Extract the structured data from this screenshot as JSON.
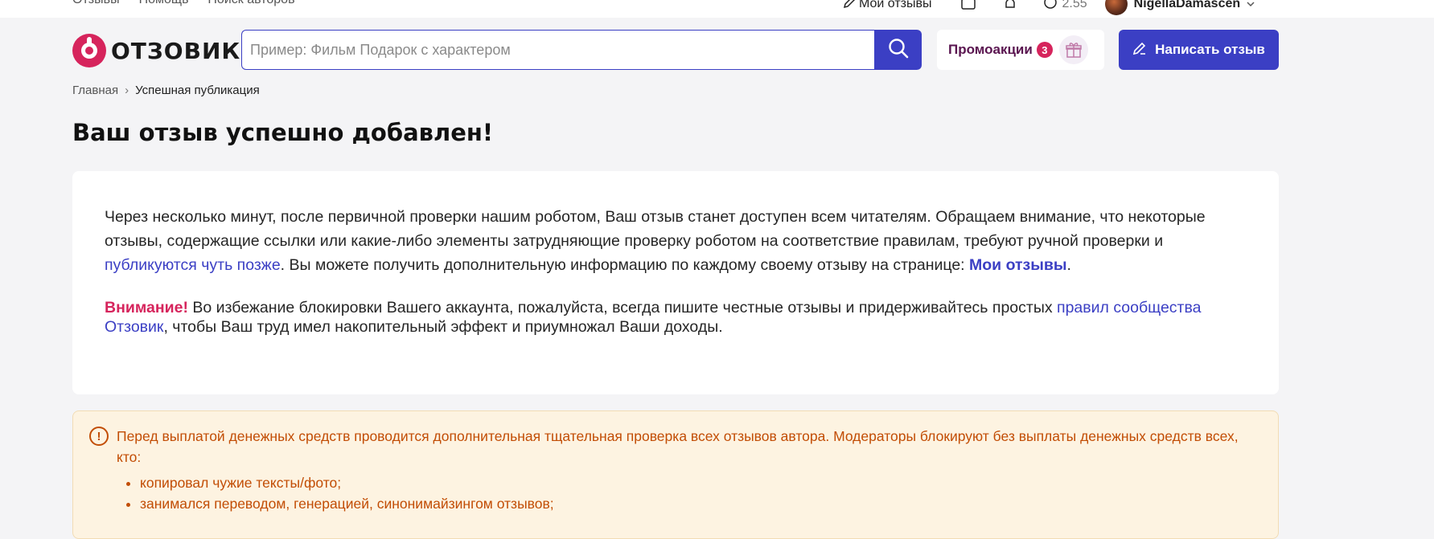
{
  "topbar": {
    "links": [
      "Отзывы",
      "Помощь",
      "Поиск авторов"
    ],
    "my_reviews": "Мои отзывы",
    "balance": "2.55",
    "username": "NigellaDamascen"
  },
  "header": {
    "logo_text": "ОТЗОВИК",
    "search_placeholder": "Пример: Фильм Подарок с характером",
    "promo_label": "Промоакции",
    "promo_count": "3",
    "write_label": "Написать отзыв"
  },
  "breadcrumb": {
    "home": "Главная",
    "separator": "›",
    "current": "Успешная публикация"
  },
  "page_title": "Ваш отзыв успешно добавлен!",
  "card": {
    "p1_start": "Через несколько минут, после первичной проверки нашим роботом, Ваш отзыв станет доступен всем читателям. Обращаем внимание, что некоторые отзывы, содержащие ссылки или какие-либо элементы затрудняющие проверку роботом на соответствие правилам, требуют ручной проверки и ",
    "p1_link": "публикуются чуть позже",
    "p1_middle": ". Вы можете получить дополнительную информацию по каждому своему отзыву на странице: ",
    "p1_bold_link": "Мои отзывы",
    "p1_end": ".",
    "p2_attention": "Внимание!",
    "p2_start": " Во избежание блокировки Вашего аккаунта, пожалуйста, всегда пишите честные отзывы и придерживайтесь простых ",
    "p2_link": "правил сообщества Отзовик",
    "p2_end": ", чтобы Ваш труд имел накопительный эффект и приумножал Ваши доходы."
  },
  "warning": {
    "icon": "!",
    "text": "Перед выплатой денежных средств проводится дополнительная тщательная проверка всех отзывов автора. Модераторы блокируют без выплаты денежных средств всех, кто:",
    "items": [
      "копировал чужие тексты/фото;",
      "занимался переводом, генерацией, синонимайзингом отзывов;"
    ]
  },
  "colors": {
    "accent": "#3b3fc4",
    "brand": "#d6245c",
    "warning_text": "#c24d05",
    "warning_bg": "#fdf3e1",
    "background": "#f4f4f6"
  },
  "icons": {
    "search": "search-icon",
    "pencil": "pencil-icon",
    "gift": "gift-icon",
    "warning": "warning-circle-icon"
  }
}
